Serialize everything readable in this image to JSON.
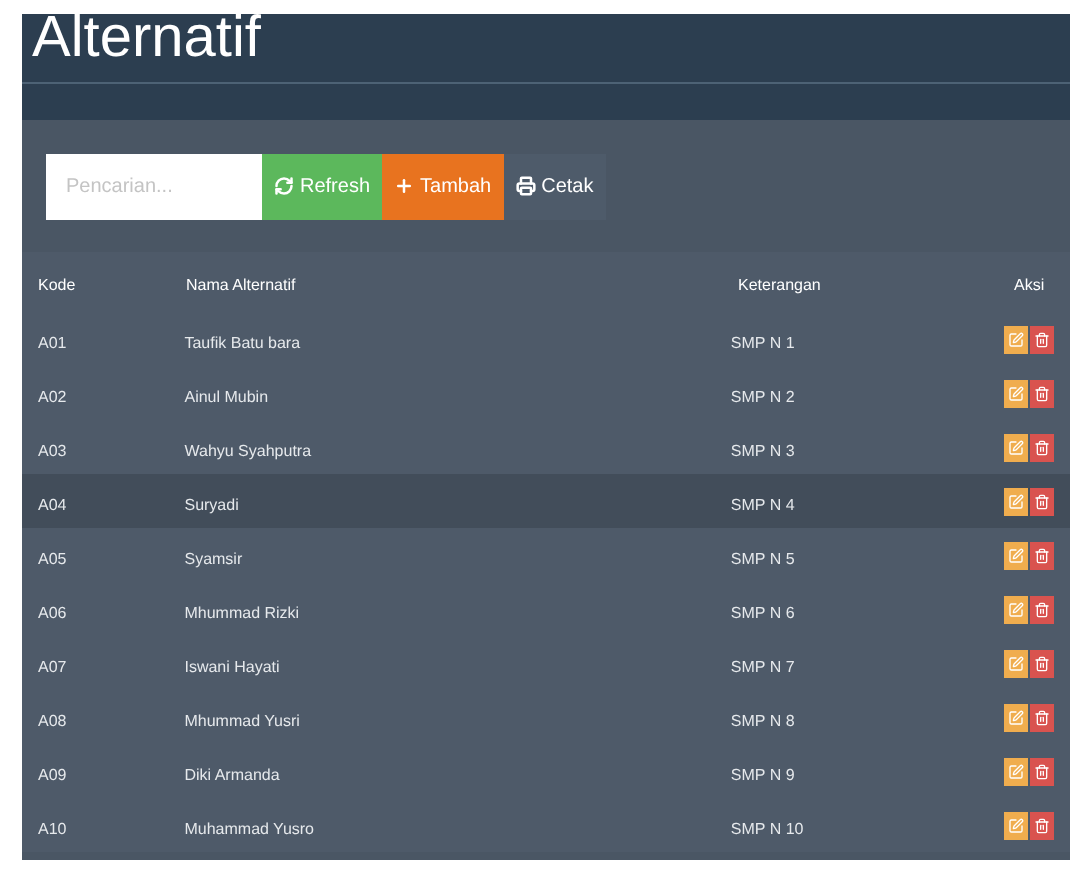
{
  "title": "Alternatif",
  "toolbar": {
    "search": {
      "placeholder": "Pencarian..."
    },
    "buttons": [
      {
        "label": "Refresh",
        "kind": "refresh"
      },
      {
        "label": "Tambah",
        "kind": "add"
      },
      {
        "label": "Cetak",
        "kind": "print"
      }
    ]
  },
  "table": {
    "columns": [
      "Kode",
      "Nama Alternatif",
      "Keterangan",
      "Aksi"
    ],
    "rows": [
      {
        "kode": "A01",
        "nama": "Taufik Batu bara",
        "keterangan": "SMP N 1",
        "selected": false
      },
      {
        "kode": "A02",
        "nama": "Ainul Mubin",
        "keterangan": "SMP N 2",
        "selected": false
      },
      {
        "kode": "A03",
        "nama": "Wahyu Syahputra",
        "keterangan": "SMP N 3",
        "selected": false
      },
      {
        "kode": "A04",
        "nama": "Suryadi",
        "keterangan": "SMP N 4",
        "selected": true
      },
      {
        "kode": "A05",
        "nama": "Syamsir",
        "keterangan": "SMP N 5",
        "selected": false
      },
      {
        "kode": "A06",
        "nama": "Mhummad Rizki",
        "keterangan": "SMP N 6",
        "selected": false
      },
      {
        "kode": "A07",
        "nama": "Iswani Hayati",
        "keterangan": "SMP N 7",
        "selected": false
      },
      {
        "kode": "A08",
        "nama": "Mhummad Yusri",
        "keterangan": "SMP N 8",
        "selected": false
      },
      {
        "kode": "A09",
        "nama": "Diki Armanda",
        "keterangan": "SMP N 9",
        "selected": false
      },
      {
        "kode": "A10",
        "nama": "Muhammad Yusro",
        "keterangan": "SMP N 10",
        "selected": false
      }
    ]
  }
}
